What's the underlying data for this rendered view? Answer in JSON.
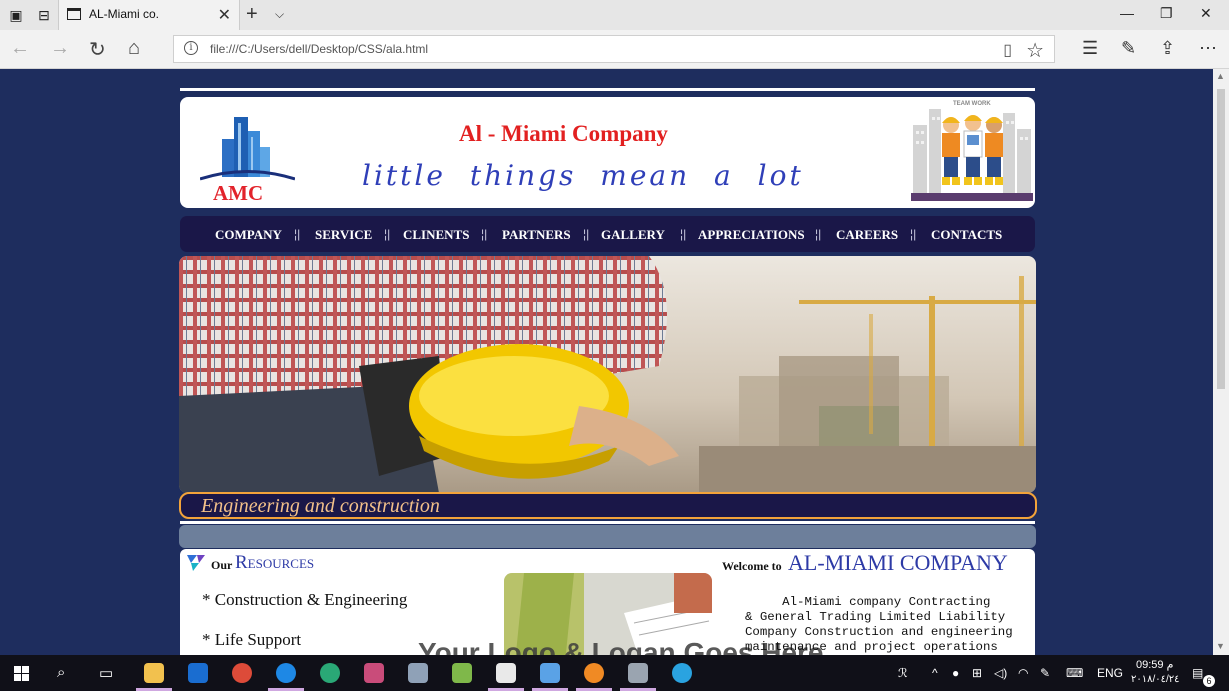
{
  "browser": {
    "tab_title": "AL-Miami co.",
    "url": "file:///C:/Users/dell/Desktop/CSS/ala.html"
  },
  "header": {
    "logo_text": "AMC",
    "company_title": "Al - Miami Company",
    "tagline": "little things mean a lot",
    "team_art_label": "TEAM WORK"
  },
  "nav": {
    "items": [
      "COMPANY",
      "SERVICE",
      "CLINENTS",
      "PARTNERS",
      "GALLERY",
      "APPRECIATIONS",
      "CAREERS",
      "CONTACTS"
    ]
  },
  "banner": {
    "text": "Engineering and construction"
  },
  "resources": {
    "our": "Our",
    "title": "Resources",
    "items": [
      "* Construction & Engineering",
      "* Life Support"
    ]
  },
  "welcome": {
    "prefix": "Welcome to",
    "name": "AL-MIAMI COMPANY",
    "text": "     Al-Miami company Contracting\n& General Trading Limited Liability\nCompany Construction and engineering\nmaintenance and project operations"
  },
  "overlay_text": "Your Logo & Logan Goes Here",
  "taskbar": {
    "language": "ENG",
    "time": "09:59 م",
    "date": "٢٠١٨/٠٤/٢٤",
    "notification_count": "6"
  }
}
